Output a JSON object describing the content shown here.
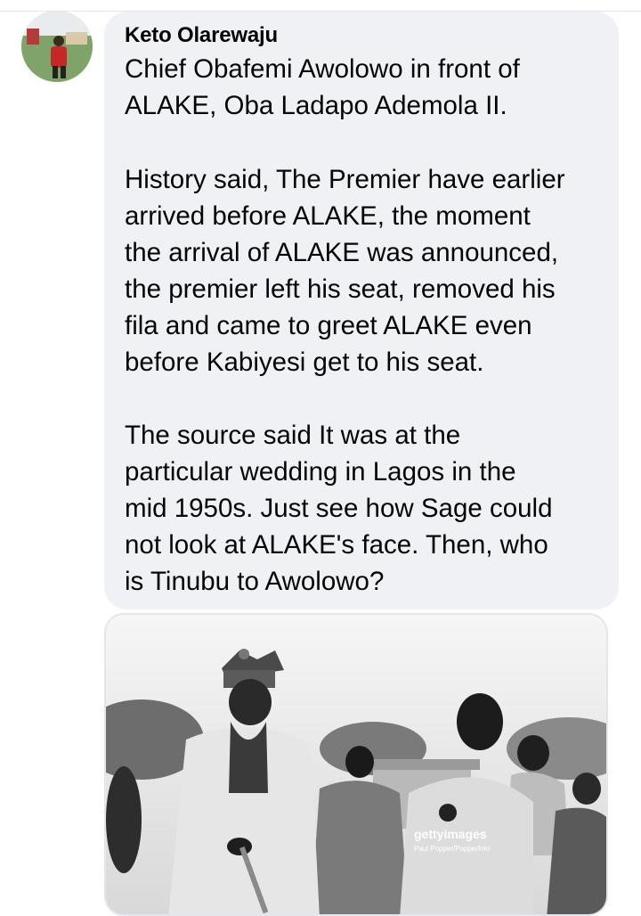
{
  "comment": {
    "author": "Keto Olarewaju",
    "paragraphs": [
      "Chief Obafemi Awolowo in front of\nALAKE, Oba Ladapo Ademola II.",
      "History said, The Premier have earlier\narrived before ALAKE, the moment\nthe arrival of ALAKE was announced,\nthe premier left his seat, removed his\nfila and came to greet ALAKE even\nbefore Kabiyesi get to his seat.",
      "The source said It was at the\nparticular wedding in Lagos in the\nmid 1950s. Just see how Sage could\nnot look at ALAKE's face. Then, who\nis Tinubu to Awolowo?"
    ]
  },
  "photo": {
    "watermark": "gettyimages",
    "credit": "Paul Popper/Popperfoto"
  },
  "colors": {
    "bubble": "#eff1f4",
    "text": "#050505",
    "divider": "#e4e6eb"
  }
}
